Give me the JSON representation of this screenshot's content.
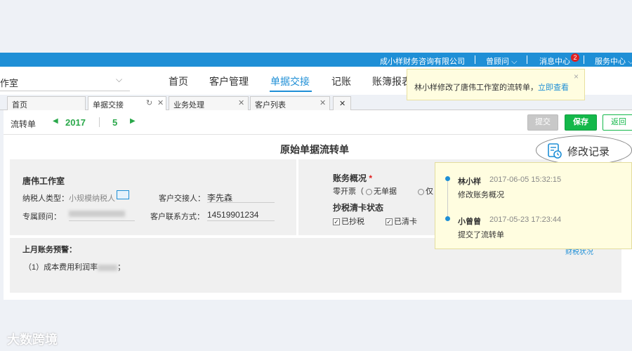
{
  "topbar": {
    "company": "成小样财务咨询有限公司",
    "advisor": "曾顾问",
    "messages": "消息中心",
    "messages_count": "2",
    "service": "服务中心"
  },
  "nav": {
    "company_select": "作室",
    "items": [
      "首页",
      "客户管理",
      "单据交接",
      "记账",
      "账簿报表"
    ]
  },
  "notification": {
    "text": "林小样修改了唐伟工作室的流转单，",
    "link": "立即查看",
    "close": "×"
  },
  "tabs": [
    {
      "label": "首页"
    },
    {
      "label": "单据交接"
    },
    {
      "label": "业务处理"
    },
    {
      "label": "客户列表"
    }
  ],
  "toolbar": {
    "label": "流转单",
    "year": "2017",
    "month": "5",
    "submit": "提交",
    "save": "保存",
    "return": "返回"
  },
  "document": {
    "title": "原始单据流转单",
    "customer_name": "唐伟工作室",
    "taxpayer_label": "纳税人类型：",
    "taxpayer_value": "小规模纳税人",
    "contact_label": "客户交接人：",
    "contact_value": "李先森",
    "advisor_label": "专属顾问：",
    "phone_label": "客户联系方式：",
    "phone_value": "14519901234",
    "account_title": "账务概况",
    "required_mark": "*",
    "zero_invoice_label": "零开票（",
    "opt_no_invoice": "无单据",
    "opt_only": "仅",
    "tax_title": "抄税清卡状态",
    "check_copied": "已抄税",
    "check_cleared": "已清卡",
    "last_month_title": "上月账务预警：",
    "warning_item": "（1）成本费用利润率",
    "warning_suffix": "；",
    "hint_link": "财税状况"
  },
  "history_button": {
    "label": "修改记录"
  },
  "history": [
    {
      "name": "林小样",
      "time": "2017-06-05 15:32:15",
      "action": "修改账务概况"
    },
    {
      "name": "小曾曾",
      "time": "2017-05-23 17:23:44",
      "action": "提交了流转单"
    }
  ],
  "watermark": "大数跨境",
  "colors": {
    "accent": "#1f8fd6",
    "save": "#14b84a",
    "badge": "#e02020",
    "highlight": "#fffde0"
  }
}
